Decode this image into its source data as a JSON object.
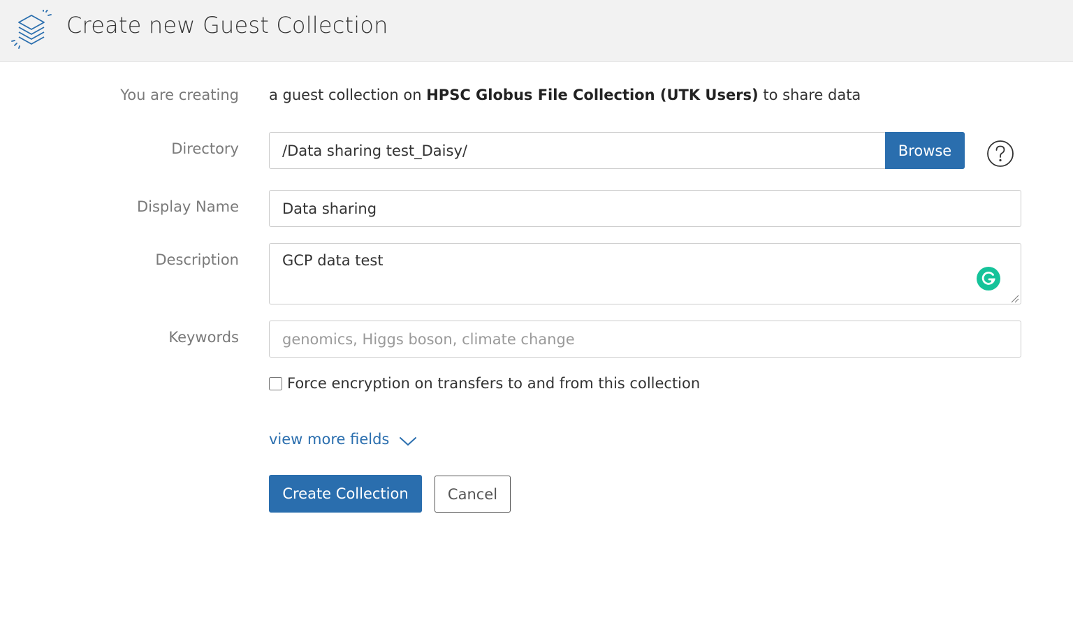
{
  "header": {
    "title": "Create new Guest Collection",
    "logo_icon": "globus-layers-icon"
  },
  "form": {
    "creating": {
      "label": "You are creating",
      "prefix": "a guest collection on",
      "endpoint": "HPSC Globus File Collection (UTK Users)",
      "suffix": "to share data"
    },
    "directory": {
      "label": "Directory",
      "value": "/Data sharing test_Daisy/",
      "browse_label": "Browse",
      "help_icon": "question-circle-icon"
    },
    "display_name": {
      "label": "Display Name",
      "value": "Data sharing"
    },
    "description": {
      "label": "Description",
      "value": "GCP data test"
    },
    "keywords": {
      "label": "Keywords",
      "value": "",
      "placeholder": "genomics, Higgs boson, climate change"
    },
    "encryption": {
      "label": "Force encryption on transfers to and from this collection",
      "checked": false
    },
    "more_fields": {
      "label": "view more fields",
      "icon": "chevron-down-icon"
    },
    "actions": {
      "create_label": "Create Collection",
      "cancel_label": "Cancel"
    }
  },
  "colors": {
    "primary": "#2a6eae",
    "header_bg": "#f2f2f2",
    "label_text": "#7a7a7a",
    "grammarly": "#15c39a"
  }
}
